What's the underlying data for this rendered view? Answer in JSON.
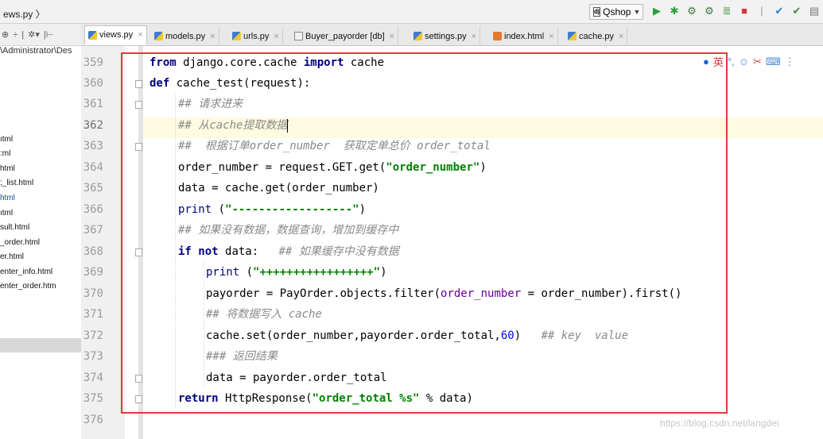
{
  "navbar": {
    "breadcrumb": "ews.py 〉",
    "run_config": "Qshop",
    "run_config_icon": "config-icon",
    "toolbar_icons": [
      "run-icon",
      "debug-icon",
      "coverage-icon",
      "profile-icon",
      "tasks-icon",
      "stop-icon",
      "vcs-update-icon",
      "vcs-commit-icon",
      "vcs-history-icon"
    ]
  },
  "project": {
    "toolbar": [
      "⊕",
      "÷",
      "|",
      "✲▾",
      "|⊢"
    ],
    "path": "\\Administrator\\Des",
    "files": [
      {
        "label": "ıtml",
        "highlight": false
      },
      {
        "label": ":ml",
        "highlight": false
      },
      {
        "label": "html",
        "highlight": false
      },
      {
        "label": ";_list.html",
        "highlight": false
      },
      {
        "label": "html",
        "highlight": true
      },
      {
        "label": "ıtml",
        "highlight": false
      },
      {
        "label": "sult.html",
        "highlight": false
      },
      {
        "label": "_order.html",
        "highlight": false
      },
      {
        "label": "er.html",
        "highlight": false
      },
      {
        "label": "enter_info.html",
        "highlight": false
      },
      {
        "label": "enter_order.htm",
        "highlight": false
      }
    ]
  },
  "tabs": [
    {
      "label": "views.py",
      "active": true,
      "icon": "python-file-icon"
    },
    {
      "label": "models.py",
      "active": false,
      "icon": "python-file-icon"
    },
    {
      "label": "urls.py",
      "active": false,
      "icon": "python-file-icon"
    },
    {
      "label": "Buyer_payorder [db]",
      "active": false,
      "icon": "db-table-icon"
    },
    {
      "label": "settings.py",
      "active": false,
      "icon": "python-file-icon"
    },
    {
      "label": "index.html",
      "active": false,
      "icon": "html-file-icon"
    },
    {
      "label": "cache.py",
      "active": false,
      "icon": "python-file-icon"
    }
  ],
  "editor": {
    "line_numbers": [
      "359",
      "360",
      "361",
      "362",
      "363",
      "364",
      "365",
      "366",
      "367",
      "368",
      "369",
      "370",
      "371",
      "372",
      "373",
      "374",
      "375",
      "376"
    ],
    "current_line": "362",
    "lines": {
      "l359": {
        "kw_from": "from",
        "module": " django.core.cache ",
        "kw_import": "import",
        "name": " cache"
      },
      "l360": {
        "kw_def": "def",
        "signature": " cache_test(request):"
      },
      "l361": {
        "comment": "## 请求进来"
      },
      "l362": {
        "comment": "## 从cache提取数据"
      },
      "l363": {
        "comment": "##  根据订单order_number  获取定单总价 order_total"
      },
      "l364": {
        "code": "order_number = request.GET.get(",
        "str": "\"order_number\"",
        "end": ")"
      },
      "l365": {
        "code": "data = cache.get(order_number)"
      },
      "l366": {
        "fn": "print",
        "space": " (",
        "str": "\"------------------\"",
        "end": ")"
      },
      "l367": {
        "comment": "## 如果没有数据，数据查询，增加到缓存中"
      },
      "l368": {
        "kw_if": "if",
        "space": " ",
        "kw_not": "not",
        "code": " data:   ",
        "comment": "## 如果缓存中没有数据"
      },
      "l369": {
        "fn": "print",
        "space": " (",
        "str": "\"+++++++++++++++++\"",
        "end": ")"
      },
      "l370": {
        "code": "payorder = PayOrder.objects.filter(",
        "param": "order_number",
        "eq": " = ",
        "code2": "order_number).first()"
      },
      "l371": {
        "comment": "## 将数据写入 cache"
      },
      "l372": {
        "code": "cache.set(order_number,payorder.order_total,",
        "num": "60",
        "end": ")   ",
        "comment": "## key  value"
      },
      "l373": {
        "comment": "### 返回结果"
      },
      "l374": {
        "code": "data = payorder.order_total"
      },
      "l375": {
        "kw_return": "return",
        "code": " HttpResponse(",
        "str": "\"order_total %s\"",
        "end": " % data)"
      }
    }
  },
  "ime": {
    "icons": [
      "ime-user-icon",
      "ime-lang-icon",
      "ime-punct-icon",
      "ime-emoji-icon",
      "ime-tools-icon",
      "ime-keyboard-icon",
      "ime-menu-icon"
    ],
    "lang_label": "英"
  },
  "watermark": "https://blog.csdn.net/langdei",
  "colors": {
    "highlight_box": "#e03a3a",
    "keyword": "#000080",
    "string": "#008000",
    "comment": "#8a8a8a",
    "number": "#0000ff"
  }
}
